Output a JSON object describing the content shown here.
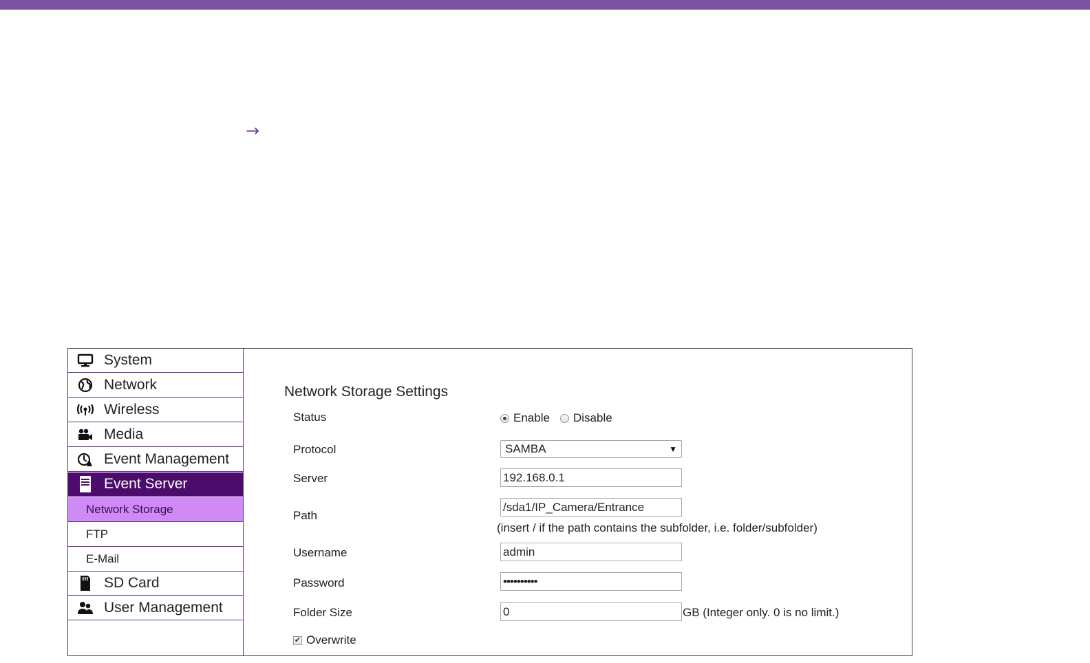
{
  "decor": {
    "arrow_glyph": "→"
  },
  "sidebar": {
    "items": [
      {
        "label": "System",
        "icon": "monitor-icon"
      },
      {
        "label": "Network",
        "icon": "globe-icon"
      },
      {
        "label": "Wireless",
        "icon": "wireless-icon"
      },
      {
        "label": "Media",
        "icon": "media-icon"
      },
      {
        "label": "Event Management",
        "icon": "event-management-icon"
      },
      {
        "label": "Event Server",
        "icon": "server-icon",
        "active": true
      },
      {
        "label": "Network Storage",
        "sub": true,
        "active": true
      },
      {
        "label": "FTP",
        "sub": true
      },
      {
        "label": "E-Mail",
        "sub": true
      },
      {
        "label": "SD Card",
        "icon": "sd-card-icon"
      },
      {
        "label": "User Management",
        "icon": "users-icon"
      }
    ]
  },
  "form": {
    "title": "Network Storage Settings",
    "status": {
      "label": "Status",
      "options": [
        "Enable",
        "Disable"
      ],
      "selected": "Enable"
    },
    "protocol": {
      "label": "Protocol",
      "value": "SAMBA"
    },
    "server": {
      "label": "Server",
      "value": "192.168.0.1"
    },
    "path": {
      "label": "Path",
      "value": "/sda1/IP_Camera/Entrance",
      "hint": "(insert / if the path contains the subfolder, i.e. folder/subfolder)"
    },
    "username": {
      "label": "Username",
      "value": "admin"
    },
    "password": {
      "label": "Password",
      "value": "••••••••••"
    },
    "folder_size": {
      "label": "Folder Size",
      "value": "0",
      "hint": "GB (Integer only. 0 is no limit.)"
    },
    "overwrite": {
      "label": "Overwrite",
      "checked": true
    }
  },
  "colors": {
    "top_bar": "#7a52a3",
    "active_item": "#4b0c6b",
    "active_sub": "#cf8af5",
    "divider": "#6a2d8f"
  }
}
